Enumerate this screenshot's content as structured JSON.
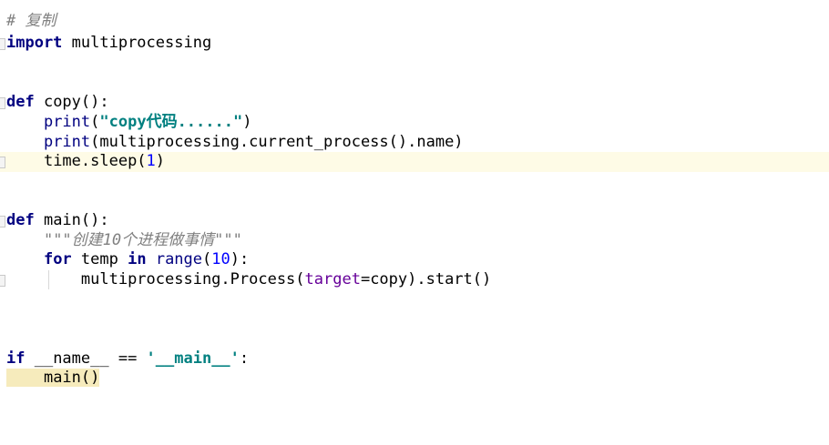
{
  "editor": {
    "lines": {
      "l1": {
        "a": "# 复制"
      },
      "l2": {
        "kw": "import",
        "rest": " multiprocessing"
      },
      "l5": {
        "kw": "def",
        "rest": " copy():"
      },
      "l6": {
        "indent": "    ",
        "fn": "print",
        "p1": "(",
        "s": "\"copy代码......\"",
        "p2": ")"
      },
      "l7": {
        "indent": "    ",
        "fn": "print",
        "rest": "(multiprocessing.current_process().name)"
      },
      "l8": {
        "indent": "    ",
        "a": "time.sleep(",
        "n": "1",
        "b": ")"
      },
      "l11": {
        "kw": "def",
        "rest": " main():"
      },
      "l12": {
        "indent": "    ",
        "doc": "\"\"\"创建10个进程做事情\"\"\""
      },
      "l13": {
        "indent": "    ",
        "kw1": "for",
        "a": " temp ",
        "kw2": "in",
        "sp": " ",
        "fn": "range",
        "p1": "(",
        "n": "10",
        "p2": "):"
      },
      "l14": {
        "indent": "        ",
        "a": "multiprocessing.Process(",
        "param": "target",
        "b": "=copy).start()"
      },
      "l17": {
        "kw": "if",
        "a": " __name__ == ",
        "s": "'__main__'",
        "b": ":"
      },
      "l18": {
        "indent": "    ",
        "a": "main()"
      }
    },
    "colors": {
      "keyword": "#000080",
      "string": "#008080",
      "number": "#0000ff",
      "comment": "#808080",
      "parameter": "#660099",
      "current_line_highlight": "#fefbe6"
    }
  }
}
